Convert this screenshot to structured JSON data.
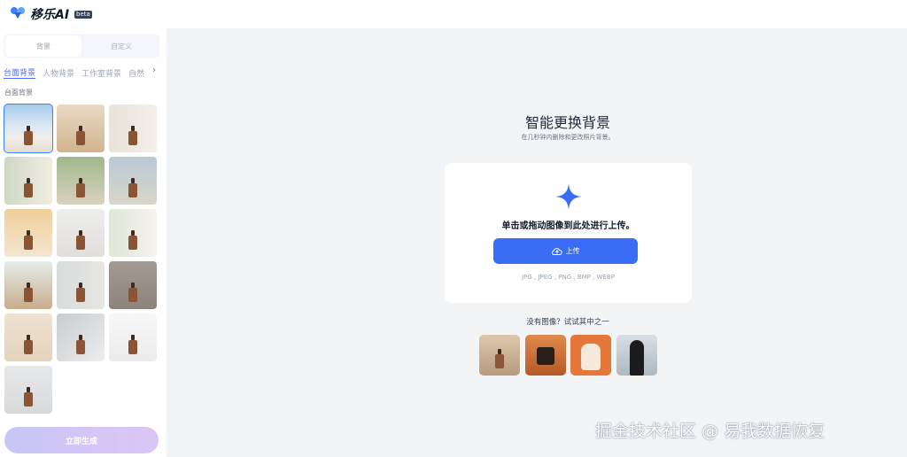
{
  "app": {
    "name": "移乐AI",
    "badge": "beta",
    "accent": "#3b6cf6"
  },
  "sidebar": {
    "tabs": [
      {
        "label": "背景",
        "active": true
      },
      {
        "label": "自定义",
        "active": false
      }
    ],
    "categories": [
      {
        "label": "台面背景",
        "active": true
      },
      {
        "label": "人物背景",
        "active": false
      },
      {
        "label": "工作室背景",
        "active": false
      },
      {
        "label": "自然",
        "active": false
      }
    ],
    "section_title": "台面背景",
    "thumbnails": [
      {
        "name": "sea-view-table",
        "selected": true
      },
      {
        "name": "warm-wood-table"
      },
      {
        "name": "kitchen-counter"
      },
      {
        "name": "palm-window"
      },
      {
        "name": "garden-view"
      },
      {
        "name": "courtyard-view"
      },
      {
        "name": "sunset-flowers"
      },
      {
        "name": "white-marble"
      },
      {
        "name": "white-flowers"
      },
      {
        "name": "flower-table"
      },
      {
        "name": "lily-vase"
      },
      {
        "name": "dark-studio"
      },
      {
        "name": "beige-wall"
      },
      {
        "name": "grey-shadow"
      },
      {
        "name": "white-pedestal"
      },
      {
        "name": "soft-grey-table"
      }
    ],
    "generate_label": "立即生成"
  },
  "main": {
    "title": "智能更换背景",
    "subtitle": "在几秒钟内删除和更改照片背景。",
    "upload": {
      "prompt": "单击或拖动图像到此处进行上传。",
      "button_label": "上传",
      "formats": "JPG , JPEG , PNG , BMP , WEBP"
    },
    "samples_title": "没有图像？试试其中之一",
    "samples": [
      {
        "name": "bottle-sample"
      },
      {
        "name": "bag-sample"
      },
      {
        "name": "dog-sample"
      },
      {
        "name": "woman-sample"
      }
    ]
  },
  "watermark": "掘金技术社区 @ 易我数据恢复"
}
